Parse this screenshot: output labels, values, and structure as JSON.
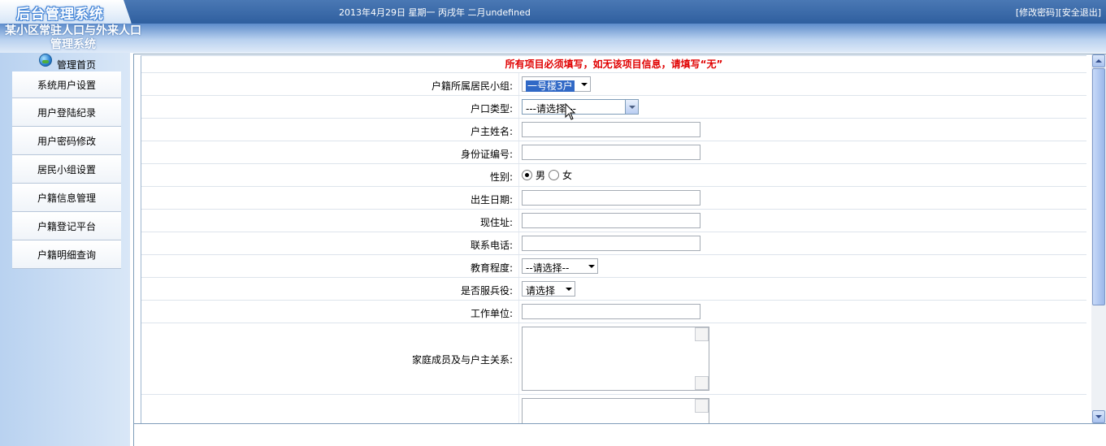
{
  "header": {
    "logo_text": "后台管理系统",
    "date_text": "2013年4月29日 星期一 丙戌年 二月undefined",
    "change_password": "[修改密码]",
    "logout": "[安全退出]",
    "system_title": "某小区常驻人口与外来人口管理系统"
  },
  "sidebar": {
    "home_label": "管理首页",
    "items": [
      {
        "label": "系统用户设置"
      },
      {
        "label": "用户登陆纪录"
      },
      {
        "label": "用户密码修改"
      },
      {
        "label": "居民小组设置"
      },
      {
        "label": "户籍信息管理"
      },
      {
        "label": "户籍登记平台"
      },
      {
        "label": "户籍明细查询"
      }
    ]
  },
  "form": {
    "notice": "所有项目必须填写，如无该项目信息，请填写“无”",
    "group_label": "户籍所属居民小组:",
    "group_value": "一号楼3户",
    "type_label": "户口类型:",
    "type_value": "---请选择---",
    "owner_label": "户主姓名:",
    "owner_value": "",
    "id_label": "身份证编号:",
    "id_value": "",
    "gender_label": "性别:",
    "gender_male": "男",
    "gender_female": "女",
    "birth_label": "出生日期:",
    "birth_value": "",
    "address_label": "现住址:",
    "address_value": "",
    "phone_label": "联系电话:",
    "phone_value": "",
    "edu_label": "教育程度:",
    "edu_value": "--请选择--",
    "military_label": "是否服兵役:",
    "military_value": "请选择",
    "work_label": "工作单位:",
    "work_value": "",
    "family_label": "家庭成员及与户主关系:",
    "family_value": ""
  }
}
